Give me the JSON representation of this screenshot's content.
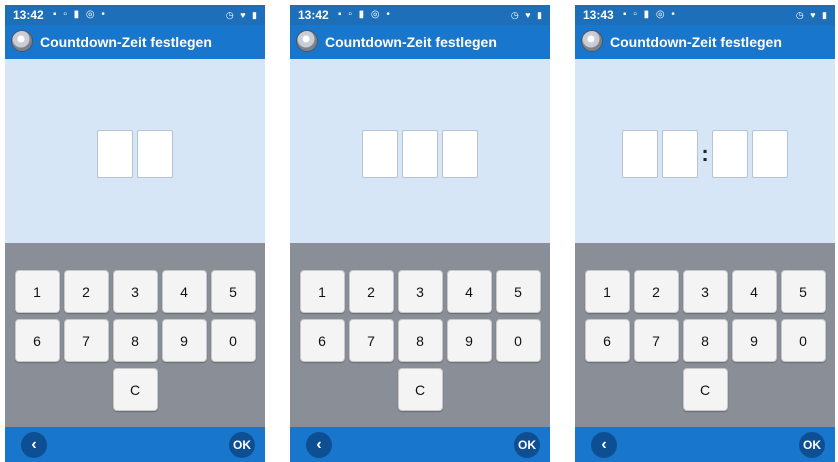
{
  "screens": [
    {
      "status_time": "13:42",
      "notif_icons": "▪ ▫ ▮ ◎ •",
      "system_icons": "◷ ♥ ▮",
      "title": "Countdown-Zeit festlegen",
      "keys_row1": [
        "1",
        "2",
        "3",
        "4",
        "5"
      ],
      "keys_row2": [
        "6",
        "7",
        "8",
        "9",
        "0"
      ],
      "clear_label": "C",
      "back_label": "‹",
      "ok_label": "OK",
      "separator": ""
    },
    {
      "status_time": "13:42",
      "notif_icons": "▪ ▫ ▮ ◎ •",
      "system_icons": "◷ ♥ ▮",
      "title": "Countdown-Zeit festlegen",
      "keys_row1": [
        "1",
        "2",
        "3",
        "4",
        "5"
      ],
      "keys_row2": [
        "6",
        "7",
        "8",
        "9",
        "0"
      ],
      "clear_label": "C",
      "back_label": "‹",
      "ok_label": "OK",
      "separator": ""
    },
    {
      "status_time": "13:43",
      "notif_icons": "▪ ▫ ▮ ◎ •",
      "system_icons": "◷ ♥ ▮",
      "title": "Countdown-Zeit festlegen",
      "keys_row1": [
        "1",
        "2",
        "3",
        "4",
        "5"
      ],
      "keys_row2": [
        "6",
        "7",
        "8",
        "9",
        "0"
      ],
      "clear_label": "C",
      "back_label": "‹",
      "ok_label": "OK",
      "separator": ":"
    }
  ]
}
